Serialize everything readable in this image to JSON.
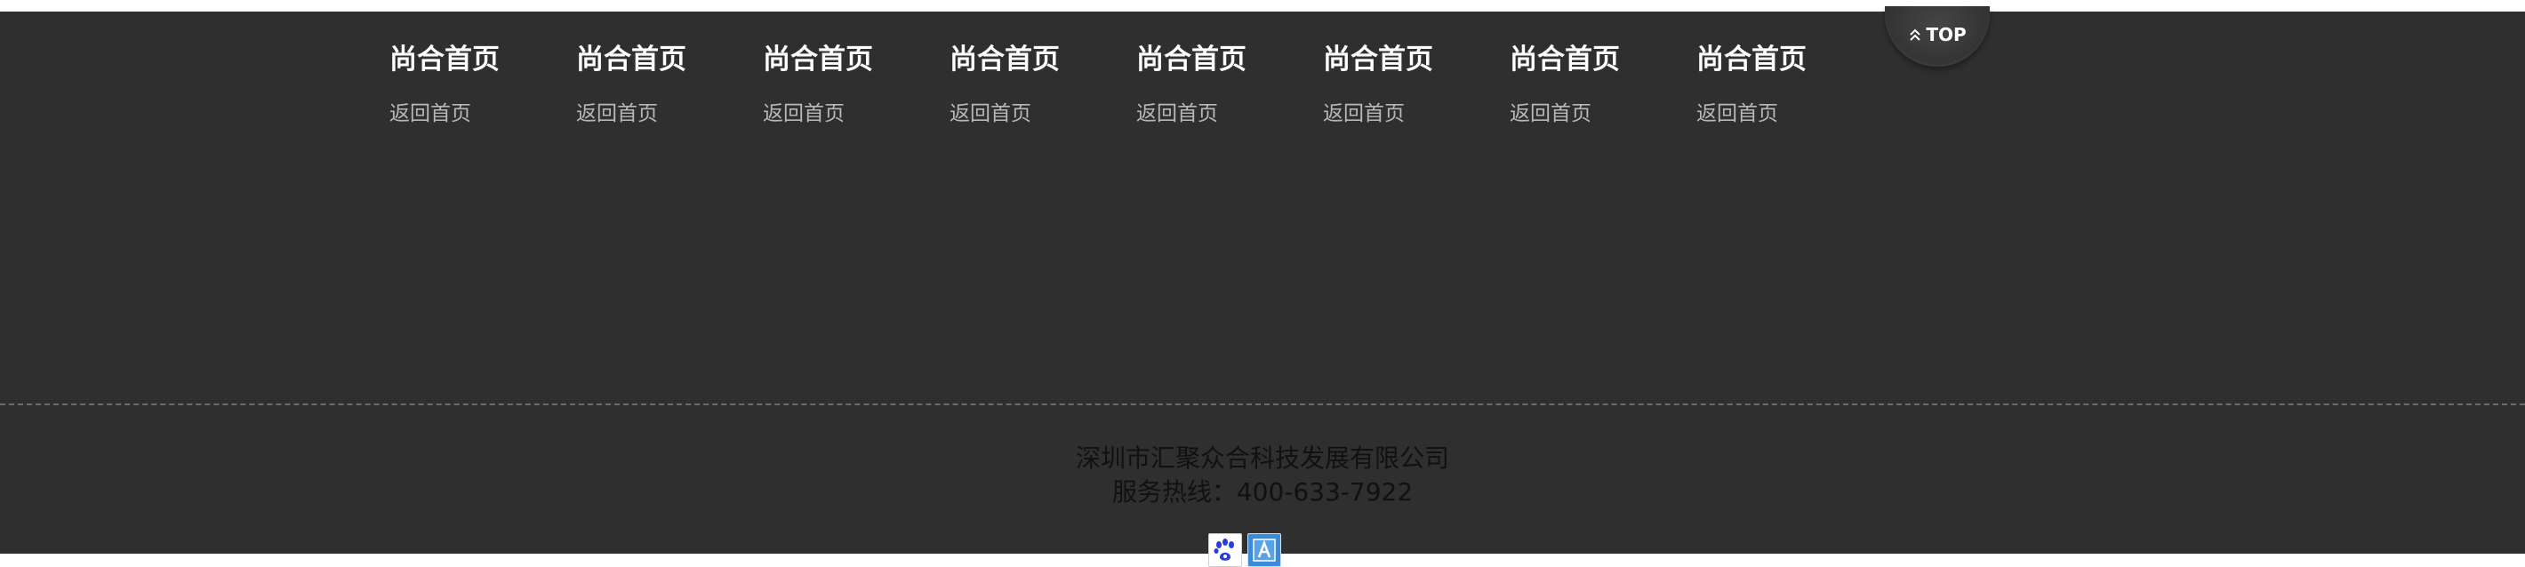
{
  "footer_nav": {
    "columns": [
      {
        "title": "尚合首页",
        "link": "返回首页"
      },
      {
        "title": "尚合首页",
        "link": "返回首页"
      },
      {
        "title": "尚合首页",
        "link": "返回首页"
      },
      {
        "title": "尚合首页",
        "link": "返回首页"
      },
      {
        "title": "尚合首页",
        "link": "返回首页"
      },
      {
        "title": "尚合首页",
        "link": "返回首页"
      },
      {
        "title": "尚合首页",
        "link": "返回首页"
      },
      {
        "title": "尚合首页",
        "link": "返回首页"
      }
    ]
  },
  "back_to_top": {
    "label": "TOP",
    "icon": "double-chevron-up-icon"
  },
  "company": {
    "name": "深圳市汇聚众合科技发展有限公司",
    "hotline": "服务热线：400-633-7922"
  },
  "badges": [
    {
      "icon": "baidu-paw-icon"
    },
    {
      "icon": "letter-a-icon"
    }
  ],
  "colors": {
    "background": "#2f2f2f",
    "title": "#ffffff",
    "link": "#b8b8b8",
    "info_text": "#111111",
    "divider": "#6b6b6b"
  }
}
